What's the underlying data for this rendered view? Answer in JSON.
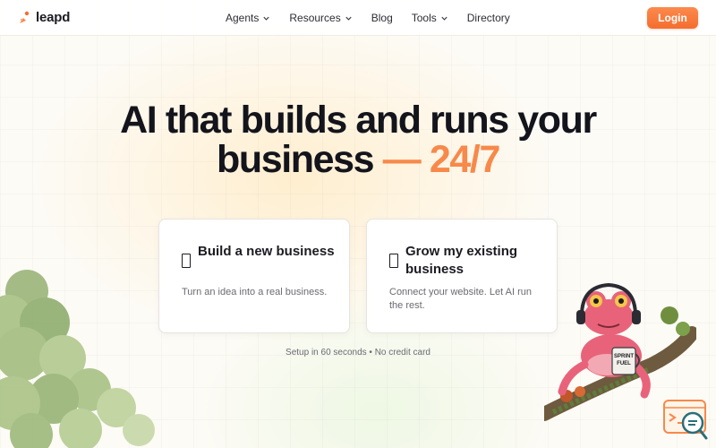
{
  "brand": {
    "name": "leapd"
  },
  "nav": {
    "items": [
      {
        "label": "Agents",
        "has_dropdown": true
      },
      {
        "label": "Resources",
        "has_dropdown": true
      },
      {
        "label": "Blog",
        "has_dropdown": false
      },
      {
        "label": "Tools",
        "has_dropdown": true
      },
      {
        "label": "Directory",
        "has_dropdown": false
      }
    ],
    "login_label": "Login"
  },
  "hero": {
    "title_line1": "AI that builds and runs your",
    "title_line2_main": "business",
    "title_line2_accent": " — 24/7"
  },
  "cards": [
    {
      "title": "Build a new business",
      "description": "Turn an idea into a real business."
    },
    {
      "title": "Grow my existing business",
      "description": "Connect your website. Let AI run the rest."
    }
  ],
  "setup_note": "Setup in 60 seconds • No credit card",
  "mascot": {
    "mug_text": "SPRINT FUEL"
  },
  "colors": {
    "accent": "#f7894a",
    "login_button": "#f46d2f",
    "text_dark": "#14141c",
    "text_muted": "#6a6a72",
    "frog_pink": "#e8637a"
  },
  "icons": {
    "logo": "leapd-logo-icon",
    "dropdown": "chevron-down-icon",
    "card_glyph": "missing-glyph-icon",
    "widget": "search-chat-icon"
  }
}
